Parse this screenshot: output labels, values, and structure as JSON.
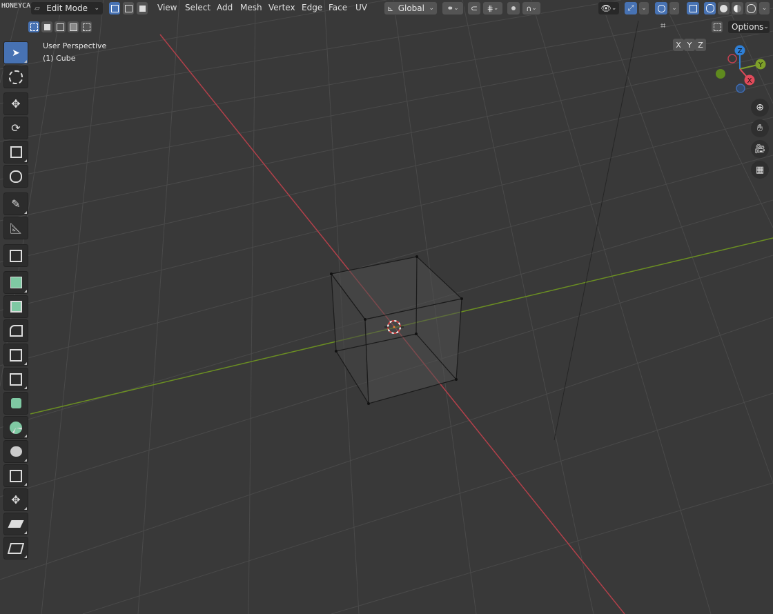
{
  "watermark": "HONEYCAM.ORG",
  "header": {
    "mode": "Edit Mode",
    "menus": [
      "View",
      "Select",
      "Add",
      "Mesh",
      "Vertex",
      "Edge",
      "Face",
      "UV"
    ],
    "transform_orientation": "Global"
  },
  "header2": {
    "axes": [
      "X",
      "Y",
      "Z"
    ],
    "options_label": "Options"
  },
  "overlay": {
    "view_name": "User Perspective",
    "object_name": "(1) Cube"
  },
  "gizmo": {
    "z_label": "Z",
    "y_label": "Y",
    "x_label": "X"
  },
  "colors": {
    "x_axis": "#b3404a",
    "y_axis": "#6b8f22",
    "active_blue": "#4772b3",
    "tool_green": "#7fc9a3"
  }
}
